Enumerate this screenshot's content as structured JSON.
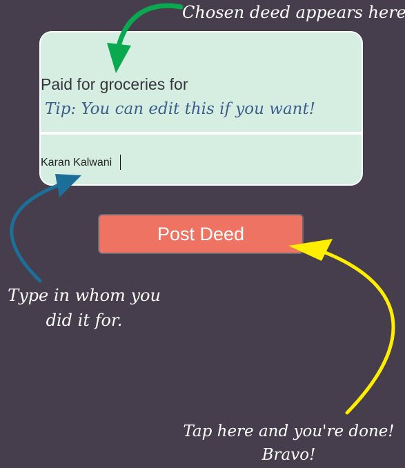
{
  "colors": {
    "background": "#463e4c",
    "card": "#d6ede2",
    "button": "#ef7362",
    "tip_text": "#3d5d8b",
    "arrow_green": "#0aa84f",
    "arrow_blue": "#1b6f99",
    "arrow_yellow": "#ffee00"
  },
  "annotations": {
    "top": "Chosen deed appears here",
    "left_line1": "Type in whom you",
    "left_line2": "did it for.",
    "bottom_line1": "Tap here and you're done!",
    "bottom_line2": "Bravo!"
  },
  "card": {
    "deed_text": "Paid for groceries for",
    "tip_text": "Tip: You can edit this if you want!",
    "recipient_value": "Karan Kalwani",
    "recipient_placeholder": ""
  },
  "button": {
    "label": "Post Deed"
  },
  "icons": {
    "green": "curved-arrow-green-icon",
    "blue": "curved-arrow-blue-icon",
    "yellow": "curved-arrow-yellow-icon"
  }
}
